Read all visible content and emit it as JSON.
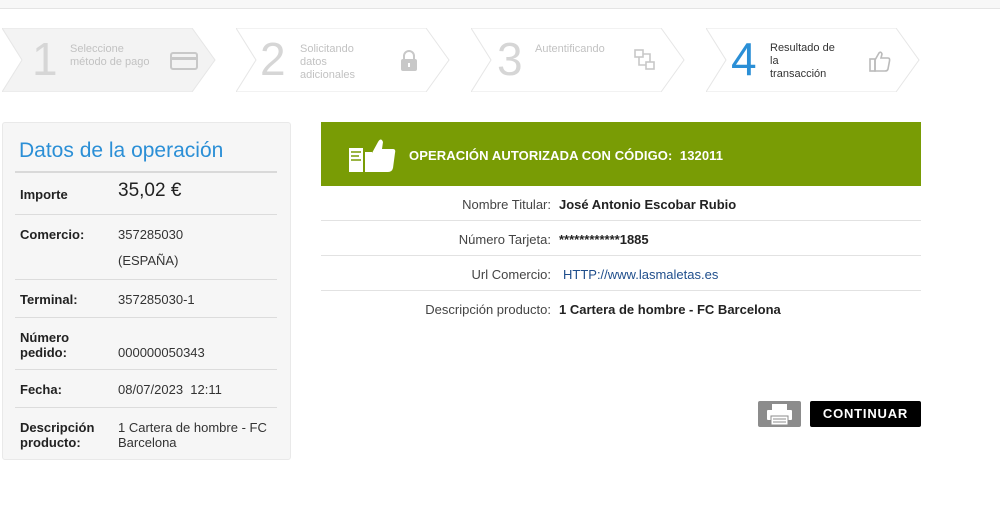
{
  "steps": [
    {
      "number": "1",
      "label_lines": [
        "Seleccione",
        "método de pago"
      ],
      "icon": "credit-card-icon",
      "active": false
    },
    {
      "number": "2",
      "label_lines": [
        "Solicitando",
        "datos",
        "adicionales"
      ],
      "icon": "lock-icon",
      "active": false
    },
    {
      "number": "3",
      "label_lines": [
        "Autentificando"
      ],
      "icon": "network-icon",
      "active": false
    },
    {
      "number": "4",
      "label_lines": [
        "Resultado de",
        "la",
        "transacción"
      ],
      "icon": "thumbs-up-icon",
      "active": true
    }
  ],
  "operation_panel": {
    "title": "Datos de la operación",
    "rows": {
      "importe": {
        "label": "Importe",
        "value": "35,02 €"
      },
      "comercio": {
        "label": "Comercio:",
        "value_lines": [
          "357285030",
          "(ESPAÑA)"
        ]
      },
      "terminal": {
        "label": "Terminal:",
        "value": "357285030-1"
      },
      "pedido": {
        "label_lines": [
          "Número",
          "pedido:"
        ],
        "value": "000000050343"
      },
      "fecha": {
        "label": "Fecha:",
        "value": "08/07/2023  12:11"
      },
      "descripcion": {
        "label_lines": [
          "Descripción",
          "producto:"
        ],
        "value_lines": [
          "1 Cartera de hombre - FC",
          "Barcelona"
        ]
      }
    }
  },
  "result": {
    "banner_text": "OPERACIÓN AUTORIZADA CON CÓDIGO:  132011",
    "details": {
      "titular": {
        "label": "Nombre Titular:",
        "value": "José Antonio Escobar Rubio"
      },
      "tarjeta": {
        "label": "Número Tarjeta:",
        "value": "************1885"
      },
      "url": {
        "label": "Url Comercio:",
        "value": "HTTP://www.lasmaletas.es"
      },
      "producto": {
        "label": "Descripción producto:",
        "value": "1 Cartera de hombre - FC Barcelona"
      }
    }
  },
  "actions": {
    "print_icon": "printer-icon",
    "continue_label": "CONTINUAR"
  },
  "colors": {
    "accent_blue": "#2b8fd6",
    "success_green": "#799c05",
    "continue_bg": "#000000"
  }
}
